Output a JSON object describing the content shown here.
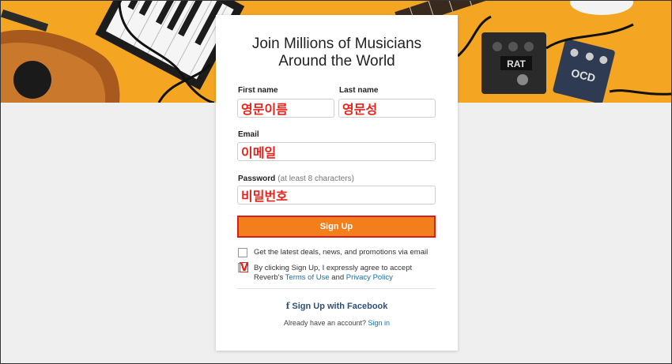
{
  "card": {
    "title_line1": "Join Millions of Musicians",
    "title_line2": "Around the World"
  },
  "form": {
    "first_name_label": "First name",
    "first_name_value": "영문이름",
    "last_name_label": "Last name",
    "last_name_value": "영문성",
    "email_label": "Email",
    "email_value": "이메일",
    "password_label": "Password",
    "password_hint": "(at least 8 characters)",
    "password_value": "비밀번호",
    "signup_label": "Sign Up"
  },
  "checkboxes": {
    "deals_label": "Get the latest deals, news, and promotions via email",
    "deals_checked": false,
    "terms_line1": "By clicking Sign Up, I expressly agree to accept",
    "terms_prefix": "Reverb's",
    "terms_link": "Terms of Use",
    "terms_and": "and",
    "privacy_link": "Privacy Policy",
    "terms_mark": "V"
  },
  "footer": {
    "facebook_icon": "facebook-icon",
    "facebook_label": "Sign Up with Facebook",
    "already_text": "Already have an account?",
    "signin_link": "Sign in"
  },
  "colors": {
    "hero_background": "#f4a623",
    "signup_button": "#f37e1c",
    "annotation_red": "#e8211b",
    "link_blue": "#1a6fa3",
    "facebook_blue": "#2d4f7c"
  }
}
